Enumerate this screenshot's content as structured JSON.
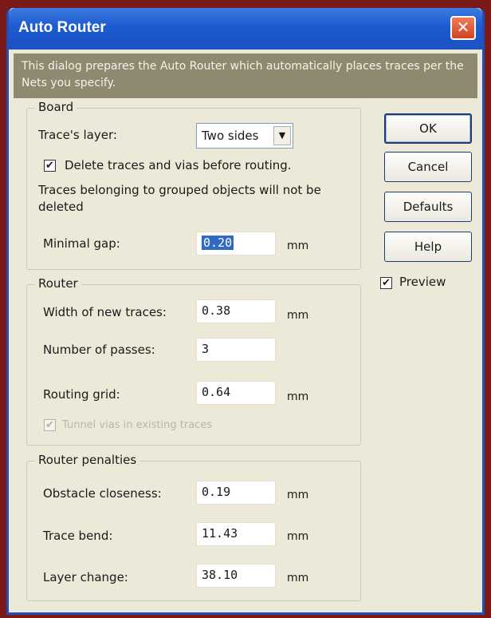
{
  "window": {
    "title": "Auto Router",
    "close_glyph": "✕"
  },
  "banner": "This dialog prepares the Auto Router which automatically places traces per the Nets you specify.",
  "board": {
    "legend": "Board",
    "layer_label": "Trace's layer:",
    "layer_value": "Two sides",
    "delete_label": "Delete  traces and vias before routing.",
    "delete_checked": true,
    "note": "Traces belonging to grouped objects will not be deleted",
    "gap_label": "Minimal gap:",
    "gap_value": "0.20",
    "gap_unit": "mm"
  },
  "router": {
    "legend": "Router",
    "width_label": "Width of new traces:",
    "width_value": "0.38",
    "width_unit": "mm",
    "passes_label": "Number of passes:",
    "passes_value": "3",
    "grid_label": "Routing grid:",
    "grid_value": "0.64",
    "grid_unit": "mm",
    "disabled_option": "Tunnel vias in existing traces"
  },
  "penalties": {
    "legend": "Router penalties",
    "obstacle_label": "Obstacle closeness:",
    "obstacle_value": "0.19",
    "obstacle_unit": "mm",
    "bend_label": "Trace bend:",
    "bend_value": "11.43",
    "bend_unit": "mm",
    "layer_change_label": "Layer change:",
    "layer_change_value": "38.10",
    "layer_change_unit": "mm"
  },
  "buttons": {
    "ok": "OK",
    "cancel": "Cancel",
    "defaults": "Defaults",
    "help": "Help"
  },
  "preview": {
    "label": "Preview",
    "checked": true
  },
  "check_glyph": "✔",
  "dropdown_glyph": "▼"
}
